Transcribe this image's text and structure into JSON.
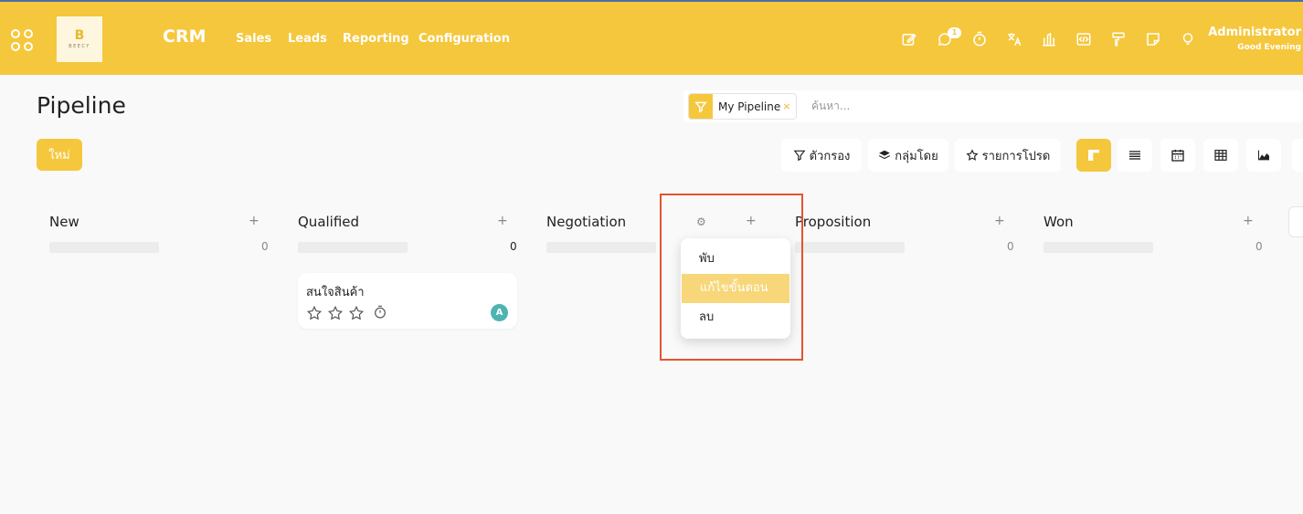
{
  "navbar": {
    "app_title": "CRM",
    "logo_text": "BEECY",
    "logo_mark": "B",
    "menu": [
      "Sales",
      "Leads",
      "Reporting",
      "Configuration"
    ],
    "chat_badge": "1",
    "user_name": "Administrator",
    "user_greeting": "Good Evening",
    "icons": [
      "edit-icon",
      "chat-icon",
      "timer-icon",
      "translate-icon",
      "bank-icon",
      "code-icon",
      "paint-roller-icon",
      "note-icon",
      "lightbulb-icon"
    ],
    "color": "#f5c73c"
  },
  "control": {
    "page_title": "Pipeline",
    "new_button": "ใหม่",
    "search_facet": "My Pipeline",
    "search_facet_remove": "×",
    "search_placeholder": "ค้นหา...",
    "filter_button": "ตัวกรอง",
    "group_button": "กลุ่มโดย",
    "favorites_button": "รายการโปรด",
    "views": [
      "kanban",
      "list",
      "calendar",
      "pivot",
      "graph"
    ]
  },
  "columns": [
    {
      "title": "New",
      "count": "0"
    },
    {
      "title": "Qualified",
      "count": "0"
    },
    {
      "title": "Negotiation",
      "count": ""
    },
    {
      "title": "Proposition",
      "count": "0"
    },
    {
      "title": "Won",
      "count": "0"
    }
  ],
  "card": {
    "title": "สนใจสินค้า",
    "avatar": "A",
    "stars": 0,
    "avatar_color": "#4eb3b1"
  },
  "dropdown": {
    "items": [
      "พับ",
      "แก้ไขขั้นตอน",
      "ลบ"
    ],
    "highlight_color": "#e2542e"
  }
}
